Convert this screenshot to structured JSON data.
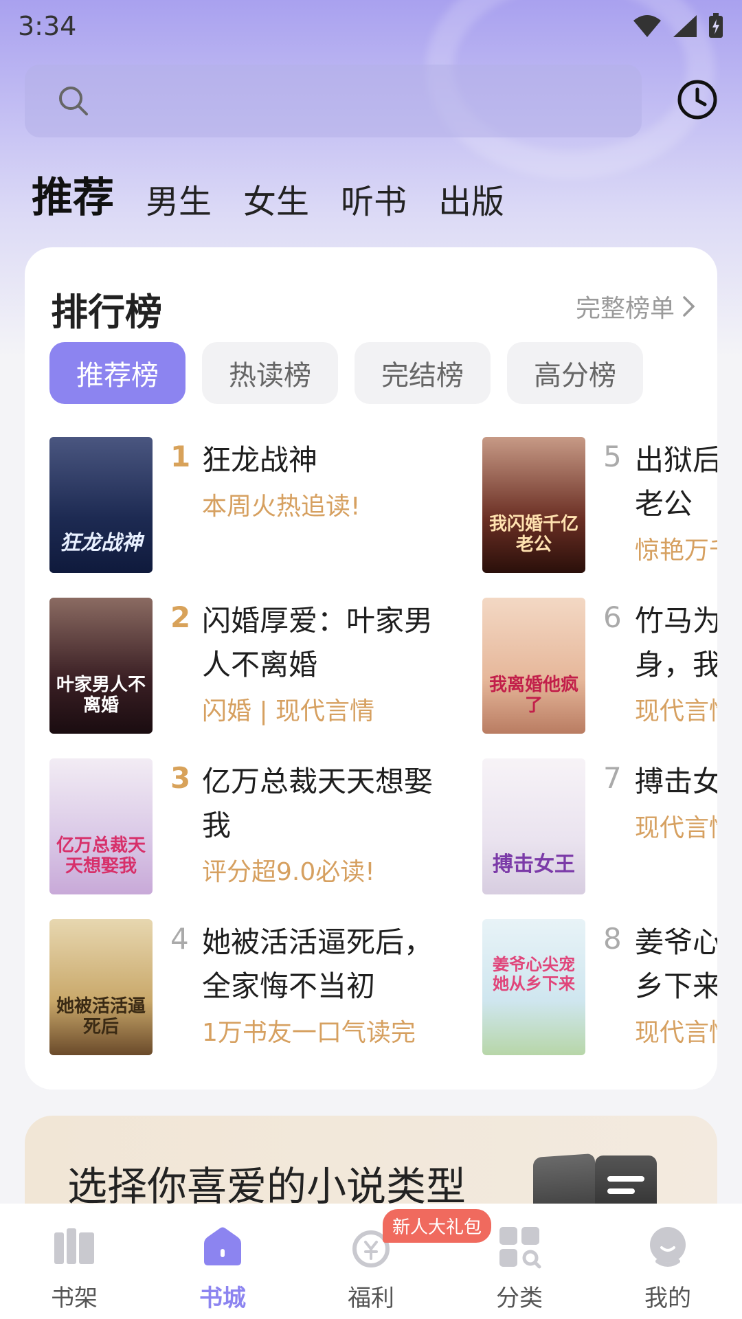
{
  "status_bar": {
    "time": "3:34"
  },
  "search": {
    "placeholder": ""
  },
  "channel_tabs": [
    {
      "label": "推荐",
      "active": true
    },
    {
      "label": "男生"
    },
    {
      "label": "女生"
    },
    {
      "label": "听书"
    },
    {
      "label": "出版"
    }
  ],
  "ranking": {
    "title": "排行榜",
    "more_label": "完整榜单",
    "tabs": [
      {
        "label": "推荐榜",
        "active": true
      },
      {
        "label": "热读榜"
      },
      {
        "label": "完结榜"
      },
      {
        "label": "高分榜"
      }
    ],
    "books": [
      {
        "rank": "1",
        "name": "狂龙战神",
        "tag": "本周火热追读!",
        "cover_text": "狂龙战神",
        "cover_color": "#1d2a52"
      },
      {
        "rank": "2",
        "name": "闪婚厚爱：叶家男人不离婚",
        "tag": "闪婚 | 现代言情",
        "cover_text": "叶家男人不离婚",
        "cover_color": "#3a1f24"
      },
      {
        "rank": "3",
        "name": "亿万总裁天天想娶我",
        "tag": "评分超9.0必读!",
        "cover_text": "亿万总裁天天想娶我",
        "cover_color": "#d9c7e6"
      },
      {
        "rank": "4",
        "name": "她被活活逼死后，全家悔不当初",
        "tag": "1万书友一口气读完",
        "cover_text": "她被活活逼死后",
        "cover_color": "#c9a86a"
      },
      {
        "rank": "5",
        "name": "出狱后我闪婚千亿老公",
        "tag": "惊艳万千",
        "cover_text": "我闪婚千亿老公",
        "cover_color": "#6b2f24"
      },
      {
        "rank": "6",
        "name": "竹马为了我的替身，我离婚他疯了",
        "tag": "现代言情",
        "cover_text": "我离婚他疯了",
        "cover_color": "#e6b79a"
      },
      {
        "rank": "7",
        "name": "搏击女王",
        "tag": "现代言情",
        "cover_text": "搏击女王",
        "cover_color": "#eae3ef"
      },
      {
        "rank": "8",
        "name": "姜爷心尖宠，她从乡下来",
        "tag": "现代言情",
        "cover_text": "姜爷心尖宠她从乡下来",
        "cover_color": "#cfe6ef"
      }
    ]
  },
  "genre_banner": {
    "title": "选择你喜爱的小说类型"
  },
  "bottom_nav": [
    {
      "label": "书架",
      "icon": "bookshelf-icon"
    },
    {
      "label": "书城",
      "icon": "home-icon",
      "active": true
    },
    {
      "label": "福利",
      "icon": "welfare-icon",
      "badge": "新人大礼包"
    },
    {
      "label": "分类",
      "icon": "category-icon"
    },
    {
      "label": "我的",
      "icon": "profile-icon"
    }
  ],
  "colors": {
    "accent": "#8c84f0",
    "tag": "#d6a060",
    "badge": "#f06a5e"
  }
}
